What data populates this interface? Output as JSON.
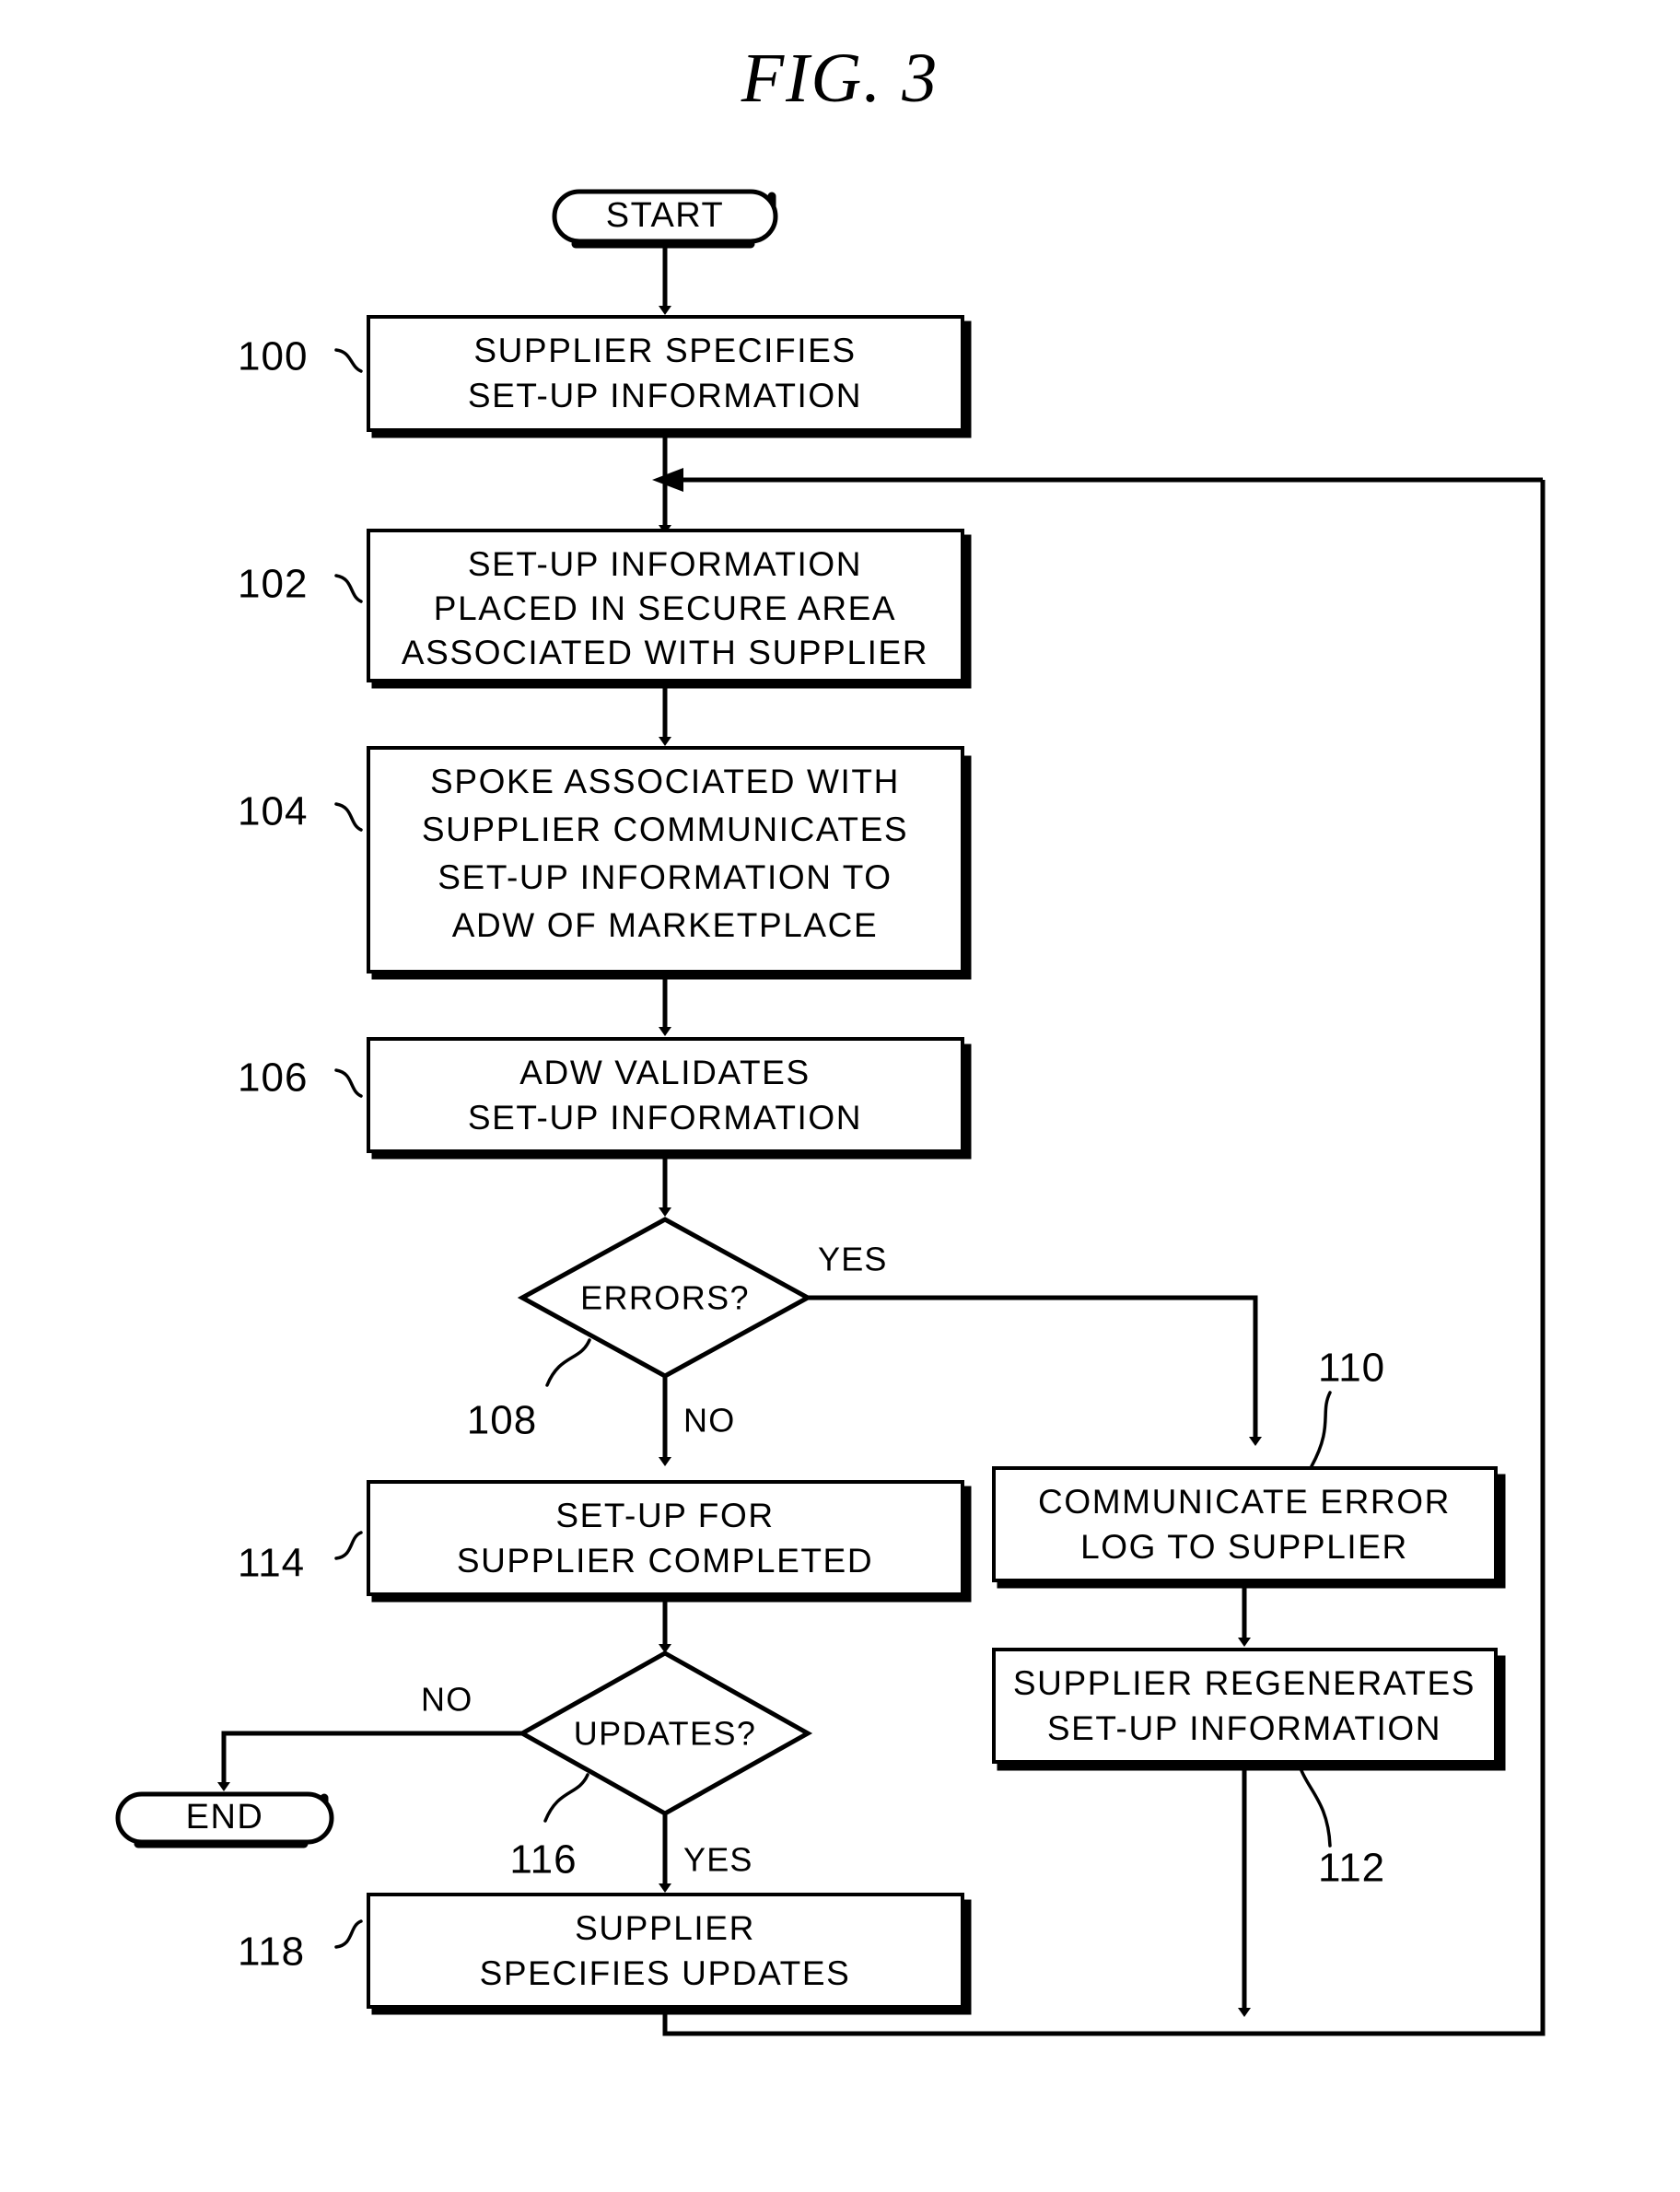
{
  "figure": {
    "title": "FIG.  3"
  },
  "terminators": {
    "start": "START",
    "end": "END"
  },
  "nodes": [
    {
      "ref": "100",
      "lines": [
        "SUPPLIER SPECIFIES",
        "SET-UP INFORMATION"
      ]
    },
    {
      "ref": "102",
      "lines": [
        "SET-UP INFORMATION",
        "PLACED IN SECURE AREA",
        "ASSOCIATED WITH SUPPLIER"
      ]
    },
    {
      "ref": "104",
      "lines": [
        "SPOKE ASSOCIATED WITH",
        "SUPPLIER COMMUNICATES",
        "SET-UP INFORMATION TO",
        "ADW OF MARKETPLACE"
      ]
    },
    {
      "ref": "106",
      "lines": [
        "ADW VALIDATES",
        "SET-UP INFORMATION"
      ]
    },
    {
      "ref": "114",
      "lines": [
        "SET-UP FOR",
        "SUPPLIER COMPLETED"
      ]
    },
    {
      "ref": "118",
      "lines": [
        "SUPPLIER",
        "SPECIFIES UPDATES"
      ]
    },
    {
      "ref": "110",
      "lines": [
        "COMMUNICATE ERROR",
        "LOG TO SUPPLIER"
      ]
    },
    {
      "ref": "112",
      "lines": [
        "SUPPLIER REGENERATES",
        "SET-UP INFORMATION"
      ]
    }
  ],
  "decisions": [
    {
      "ref": "108",
      "label": "ERRORS?",
      "branch_yes": "YES",
      "branch_no": "NO"
    },
    {
      "ref": "116",
      "label": "UPDATES?",
      "branch_yes": "YES",
      "branch_no": "NO"
    }
  ],
  "colors": {
    "ink": "#000000",
    "paper": "#ffffff"
  }
}
